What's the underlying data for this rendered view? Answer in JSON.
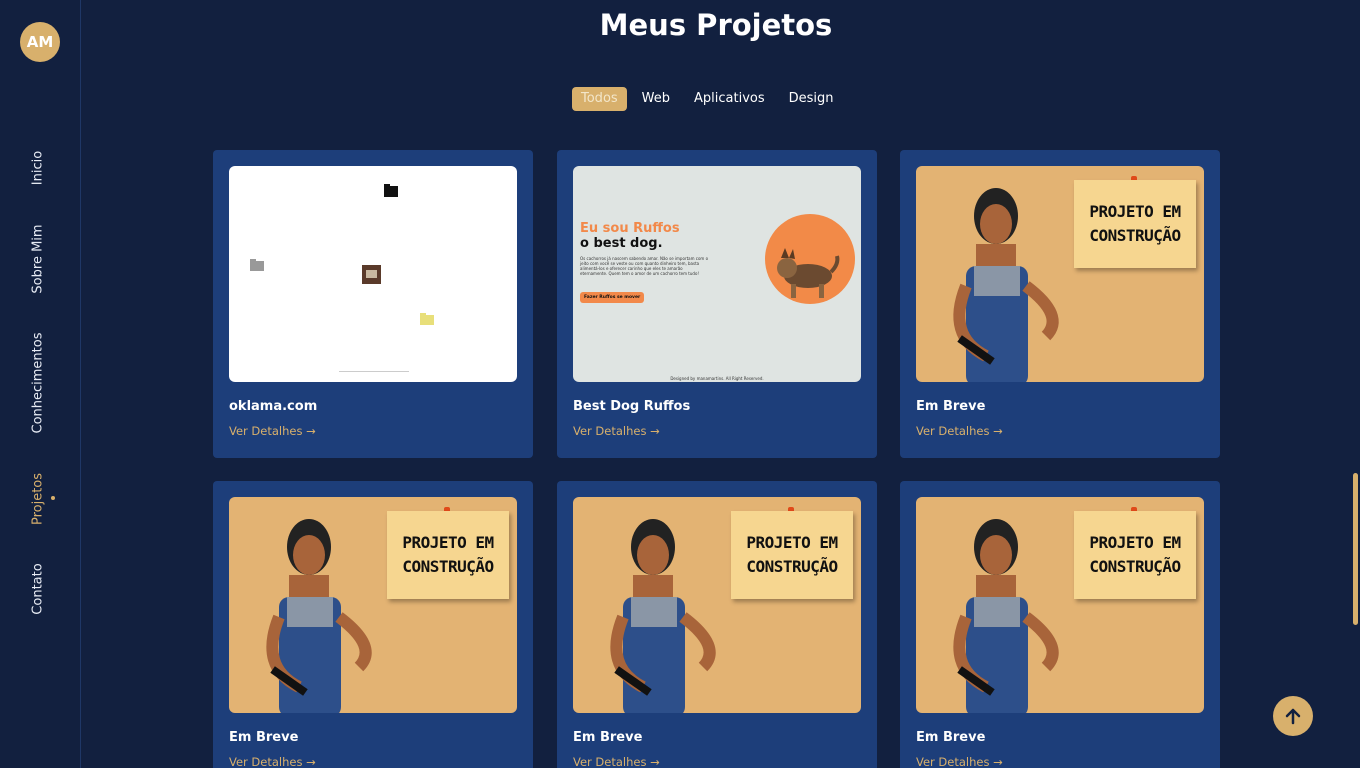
{
  "profile": {
    "initials": "AM"
  },
  "nav": {
    "items": [
      {
        "label": "Inicio",
        "active": false
      },
      {
        "label": "Sobre Mim",
        "active": false
      },
      {
        "label": "Conhecimentos",
        "active": false
      },
      {
        "label": "Projetos",
        "active": true
      },
      {
        "label": "Contato",
        "active": false
      }
    ]
  },
  "main": {
    "title": "Meus Projetos",
    "filters": [
      {
        "label": "Todos",
        "active": true
      },
      {
        "label": "Web",
        "active": false
      },
      {
        "label": "Aplicativos",
        "active": false
      },
      {
        "label": "Design",
        "active": false
      }
    ],
    "projects": [
      {
        "title": "oklama.com",
        "link": "Ver Detalhes →",
        "thumbnail": "oklama-desktop"
      },
      {
        "title": "Best Dog Ruffos",
        "link": "Ver Detalhes →",
        "thumbnail": "ruffos-landing"
      },
      {
        "title": "Em Breve",
        "link": "Ver Detalhes →",
        "thumbnail": "em-construcao"
      },
      {
        "title": "Em Breve",
        "link": "Ver Detalhes →",
        "thumbnail": "em-construcao"
      },
      {
        "title": "Em Breve",
        "link": "Ver Detalhes →",
        "thumbnail": "em-construcao"
      },
      {
        "title": "Em Breve",
        "link": "Ver Detalhes →",
        "thumbnail": "em-construcao"
      }
    ]
  },
  "thumbs": {
    "ruffos": {
      "headline1": "Eu sou Ruffos",
      "headline2": "o best dog.",
      "body": "Os cachorros já nascem sabendo amar. Não se importam com o jeito com você se veste ou com quanto dinheiro tem, basta alimentá-los e oferecer carinho que eles te amarão eternamente. Quem tem o amor de um cachorro tem tudo!",
      "button": "Fazer Ruffos se mover",
      "footer": "Designed by manamartins. All Right Reserved."
    },
    "construction": {
      "line1": "PROJETO EM",
      "line2": "CONSTRUÇÃO"
    }
  },
  "colors": {
    "background": "#12203f",
    "card": "#1d3e7a",
    "accent": "#d8b06c"
  },
  "icons": {
    "scroll_top": "arrow-up-icon",
    "link_arrow": "arrow-right-icon"
  }
}
